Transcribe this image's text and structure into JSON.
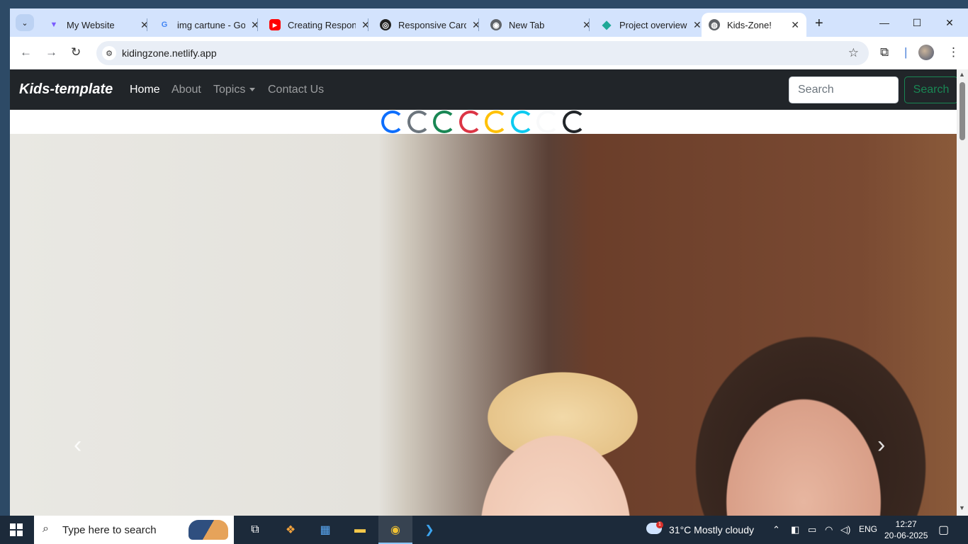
{
  "tabs": [
    {
      "title": "My Website",
      "fav_color": "#7a5cff",
      "fav_glyph": "▼"
    },
    {
      "title": "img cartune - Go",
      "fav_color": "#4285f4",
      "fav_glyph": "G"
    },
    {
      "title": "Creating Respon",
      "fav_color": "#ff0000",
      "fav_glyph": "▶"
    },
    {
      "title": "Responsive Card",
      "fav_color": "#222222",
      "fav_glyph": "◎"
    },
    {
      "title": "New Tab",
      "fav_color": "#5f6368",
      "fav_glyph": "◉"
    },
    {
      "title": "Project overview",
      "fav_color": "#1fa897",
      "fav_glyph": "◆"
    },
    {
      "title": "Kids-Zone!",
      "fav_color": "#5f6368",
      "fav_glyph": "◍",
      "active": true
    }
  ],
  "url": "kidingzone.netlify.app",
  "site": {
    "brand": "Kids-template",
    "nav": [
      "Home",
      "About",
      "Topics",
      "Contact Us"
    ],
    "search_placeholder": "Search",
    "search_button": "Search",
    "spinner_colors": [
      "#0d6efd",
      "#6c757d",
      "#198754",
      "#dc3545",
      "#ffc107",
      "#0dcaf0",
      "#f8f9fa",
      "#212529"
    ]
  },
  "carousel": {
    "prev_icon": "‹",
    "next_icon": "›"
  },
  "taskbar": {
    "search_text": "Type here to search",
    "weather": "31°C  Mostly cloudy",
    "weather_badge": "1",
    "language": "ENG",
    "time": "12:27",
    "date": "20-06-2025"
  }
}
